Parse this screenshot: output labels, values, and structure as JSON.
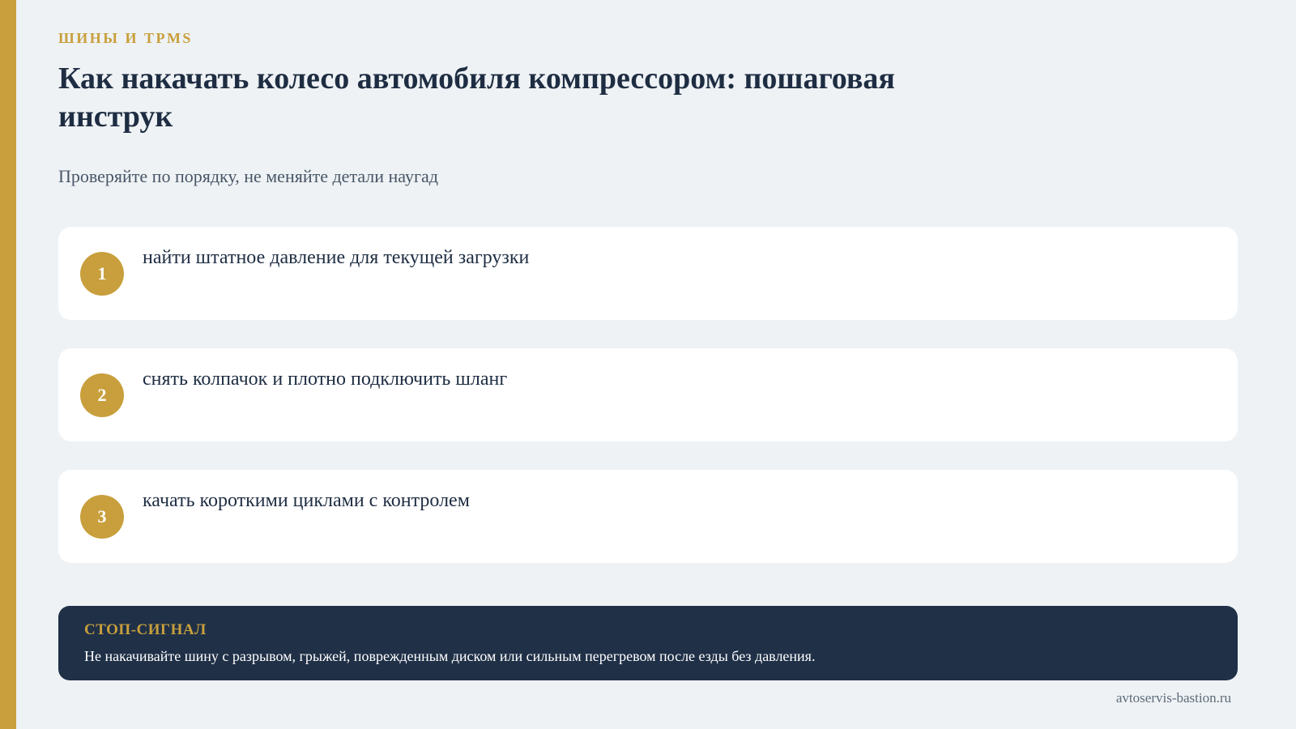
{
  "category": "ШИНЫ И TPMS",
  "title": "Как накачать колесо автомобиля компрессором: пошаговая инструк",
  "subtitle": "Проверяйте по порядку, не меняйте детали наугад",
  "steps": [
    {
      "number": "1",
      "text": "найти штатное давление для текущей загрузки"
    },
    {
      "number": "2",
      "text": "снять колпачок и плотно подключить шланг"
    },
    {
      "number": "3",
      "text": "качать короткими циклами с контролем"
    }
  ],
  "alert": {
    "title": "СТОП-СИГНАЛ",
    "text": "Не накачивайте шину с разрывом, грыжей, поврежденным диском или сильным перегревом после езды без давления."
  },
  "site": "avtoservis-bastion.ru",
  "colors": {
    "accent": "#c89f3c",
    "navy": "#1f3047",
    "background": "#eef2f5"
  }
}
